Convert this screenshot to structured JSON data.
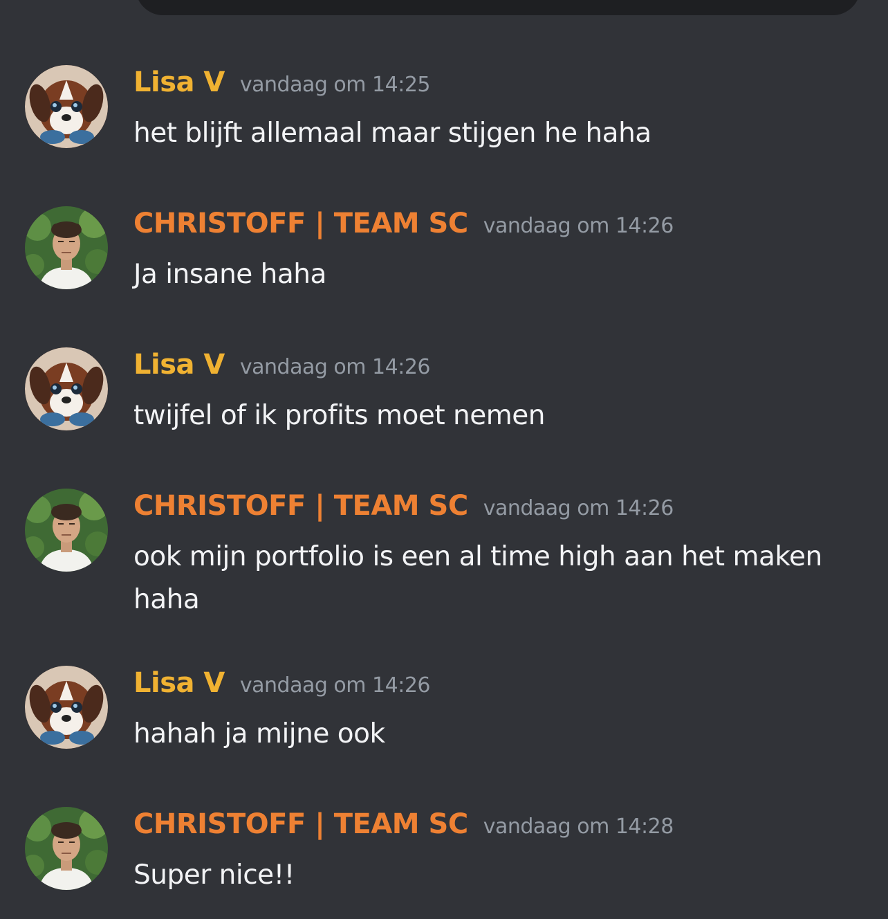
{
  "colors": {
    "background": "#313338",
    "lisa_name": "#f0b232",
    "christoff_name": "#ee8133",
    "timestamp": "#949ba4",
    "message_text": "#f2f3f5"
  },
  "messages": [
    {
      "author": "Lisa V",
      "avatar_icon": "puppy-avatar-icon",
      "timestamp": "vandaag om 14:25",
      "text": "het blijft allemaal maar stijgen he haha"
    },
    {
      "author": "CHRISTOFF | TEAM SC",
      "avatar_icon": "man-portrait-avatar-icon",
      "timestamp": "vandaag om 14:26",
      "text": "Ja insane haha"
    },
    {
      "author": "Lisa V",
      "avatar_icon": "puppy-avatar-icon",
      "timestamp": "vandaag om 14:26",
      "text": "twijfel of ik profits moet nemen"
    },
    {
      "author": "CHRISTOFF | TEAM SC",
      "avatar_icon": "man-portrait-avatar-icon",
      "timestamp": "vandaag om 14:26",
      "text": "ook mijn portfolio is een al time high aan het maken haha"
    },
    {
      "author": "Lisa V",
      "avatar_icon": "puppy-avatar-icon",
      "timestamp": "vandaag om 14:26",
      "text": "hahah ja mijne ook"
    },
    {
      "author": "CHRISTOFF | TEAM SC",
      "avatar_icon": "man-portrait-avatar-icon",
      "timestamp": "vandaag om 14:28",
      "text": "Super nice!!"
    }
  ]
}
